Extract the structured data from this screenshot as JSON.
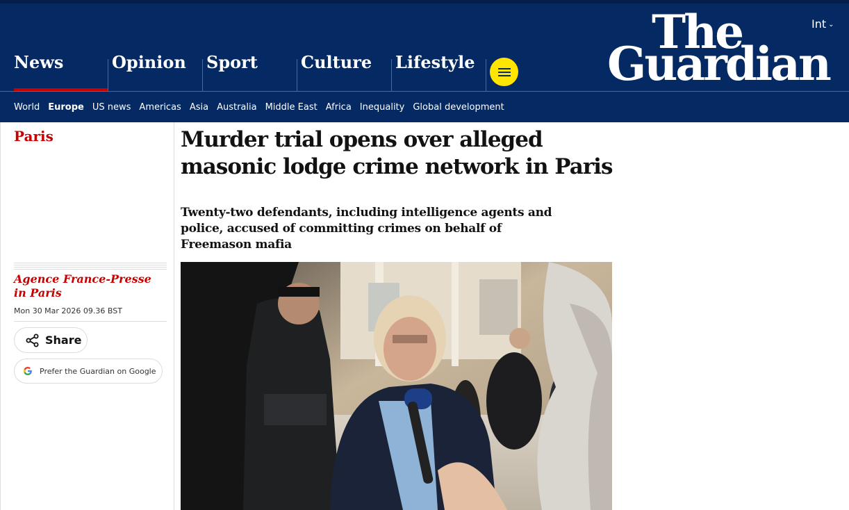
{
  "header": {
    "edition": "Int",
    "logo_line1": "The",
    "logo_line2": "Guardian",
    "pillars": [
      {
        "label": "News",
        "active": true
      },
      {
        "label": "Opinion",
        "active": false
      },
      {
        "label": "Sport",
        "active": false
      },
      {
        "label": "Culture",
        "active": false
      },
      {
        "label": "Lifestyle",
        "active": false
      }
    ],
    "colors": {
      "brand_blue": "#052962",
      "accent_red": "#c70000",
      "menu_yellow": "#ffe500"
    }
  },
  "subnav": {
    "items": [
      "World",
      "Europe",
      "US news",
      "Americas",
      "Asia",
      "Australia",
      "Middle East",
      "Africa",
      "Inequality",
      "Global development"
    ],
    "active": "Europe"
  },
  "article": {
    "section": "Paris",
    "headline": "Murder trial opens over alleged masonic lodge crime network in Paris",
    "standfirst": "Twenty-two defendants, including intelligence agents and police, accused of committing crimes on behalf of Freemason mafia",
    "byline": "Agence France-Presse in Paris",
    "date": "Mon 30 Mar 2026 09.36 BST",
    "share_label": "Share",
    "google_label": "Prefer the Guardian on Google",
    "image_icon": "news-photo"
  }
}
